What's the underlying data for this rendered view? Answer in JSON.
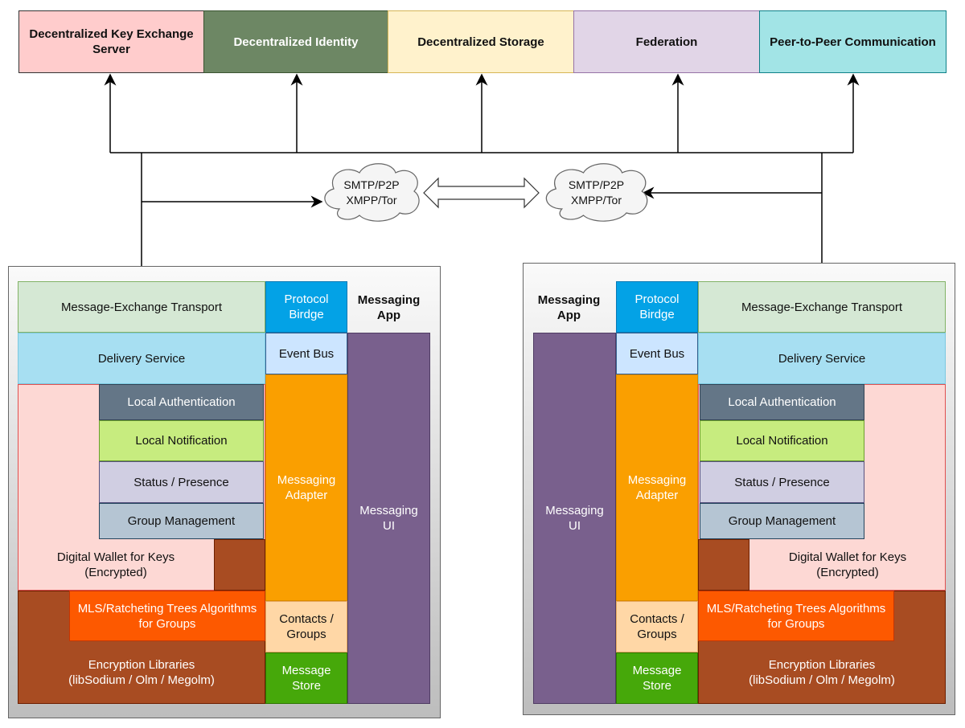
{
  "top_services": [
    {
      "label": "Decentralized Key Exchange\nServer",
      "color": "#ffcccc"
    },
    {
      "label": "Decentralized Identity",
      "color": "#6d8764"
    },
    {
      "label": "Decentralized Storage",
      "color": "#fff2cc"
    },
    {
      "label": "Federation",
      "color": "#e1d5e7"
    },
    {
      "label": "Peer-to-Peer Communication",
      "color": "#a2e4e6"
    }
  ],
  "clouds": [
    {
      "label": "SMTP/P2P\nXMPP/Tor"
    },
    {
      "label": "SMTP/P2P\nXMPP/Tor"
    }
  ],
  "app": {
    "title": "Messaging\nApp",
    "transport": "Message-Exchange Transport",
    "bridge": "Protocol\nBirdge",
    "delivery": "Delivery Service",
    "event_bus": "Event Bus",
    "adapter": "Messaging\nAdapter",
    "contacts": "Contacts /\nGroups",
    "store": "Message\nStore",
    "ui": "Messaging\nUI",
    "local_auth": "Local Authentication",
    "local_notification": "Local Notification",
    "status": "Status / Presence",
    "group_mgmt": "Group Management",
    "wallet": "Digital Wallet for Keys\n(Encrypted)",
    "mls": "MLS/Ratcheting Trees Algorithms\nfor Groups",
    "encryption": "Encryption Libraries\n(libSodium / Olm / Megolm)"
  }
}
